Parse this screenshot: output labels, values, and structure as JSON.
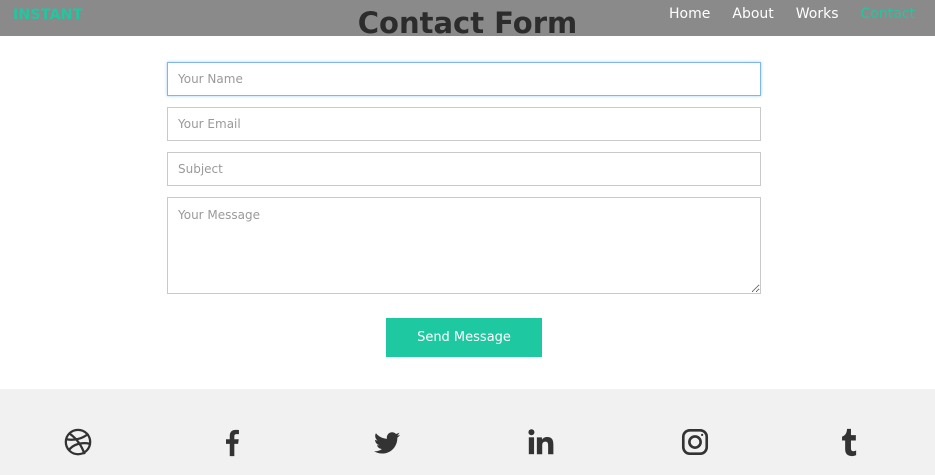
{
  "nav": {
    "brand": "INSTANT",
    "title": "Contact Form",
    "links": [
      {
        "label": "Home",
        "active": false
      },
      {
        "label": "About",
        "active": false
      },
      {
        "label": "Works",
        "active": false
      },
      {
        "label": "Contact",
        "active": true
      }
    ]
  },
  "form": {
    "name_placeholder": "Your Name",
    "email_placeholder": "Your Email",
    "subject_placeholder": "Subject",
    "message_placeholder": "Your Message",
    "submit_label": "Send Message"
  },
  "footer": {
    "social": [
      "dribbble-icon",
      "facebook-icon",
      "twitter-icon",
      "linkedin-icon",
      "instagram-icon",
      "tumblr-icon"
    ]
  },
  "colors": {
    "accent": "#1ec8a0",
    "navbar": "#8a8a8a",
    "footer": "#f1f1f1"
  }
}
